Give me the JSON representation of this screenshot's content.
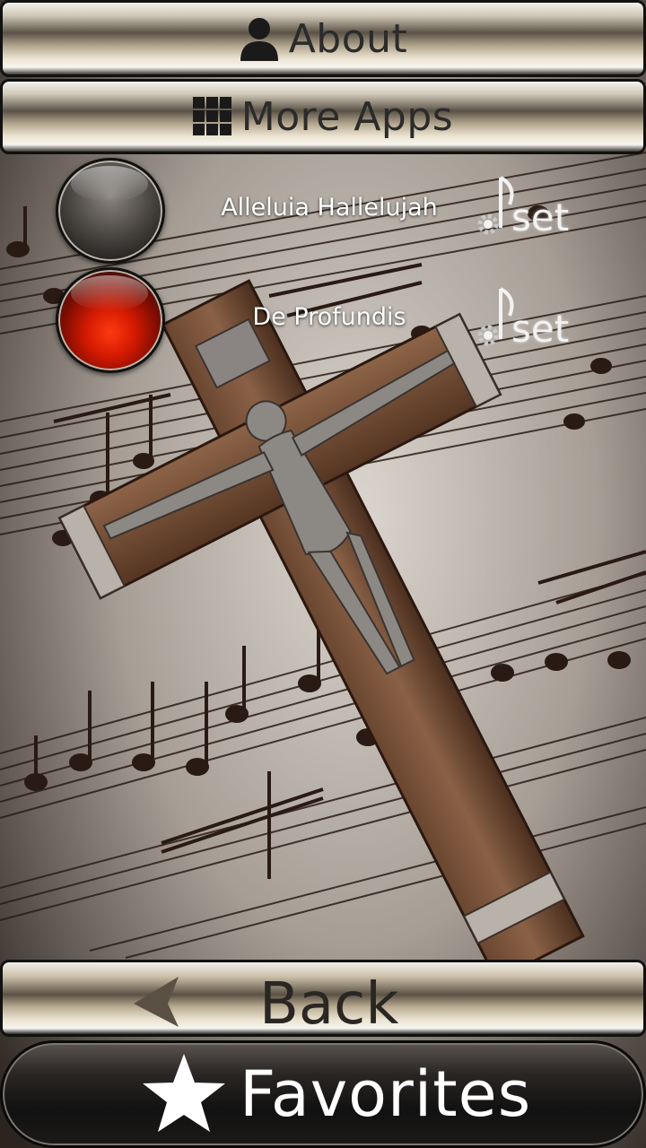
{
  "header": {
    "about_label": "About",
    "more_apps_label": "More Apps"
  },
  "songs": [
    {
      "title": "Alleluia Hallelujah",
      "playing": false,
      "set_label": "set"
    },
    {
      "title": "De Profundis",
      "playing": true,
      "set_label": "set"
    }
  ],
  "footer": {
    "back_label": "Back",
    "favorites_label": "Favorites"
  },
  "colors": {
    "playing_indicator": "#d41a02",
    "title_text": "#ffffff"
  },
  "icons": {
    "about": "person-icon",
    "more_apps": "grid-icon",
    "back": "back-arrow-icon",
    "favorites": "star-icon",
    "set": "music-note-gear-icon"
  }
}
